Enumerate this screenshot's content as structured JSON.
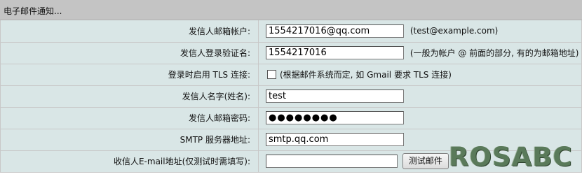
{
  "header": {
    "title": "电子邮件通知..."
  },
  "rows": [
    {
      "label": "发信人邮箱帐户:",
      "value": "1554217016@qq.com",
      "hint": "(test@example.com)"
    },
    {
      "label": "发信人登录验证名:",
      "value": "1554217016",
      "hint": "(一般为帐户 @ 前面的部分, 有的为邮箱地址)"
    },
    {
      "label": "登录时启用 TLS 连接:",
      "checked": false,
      "hint": "(根据邮件系统而定, 如 Gmail 要求 TLS 连接)"
    },
    {
      "label": "发信人名字(姓名):",
      "value": "test"
    },
    {
      "label": "发信人邮箱密码:",
      "value": "●●●●●●●●"
    },
    {
      "label": "SMTP 服务器地址:",
      "value": "smtp.qq.com"
    },
    {
      "label": "收信人E-mail地址(仅测试时需填写):",
      "value": "",
      "button": "测试邮件"
    }
  ],
  "watermark": "ROSABC"
}
